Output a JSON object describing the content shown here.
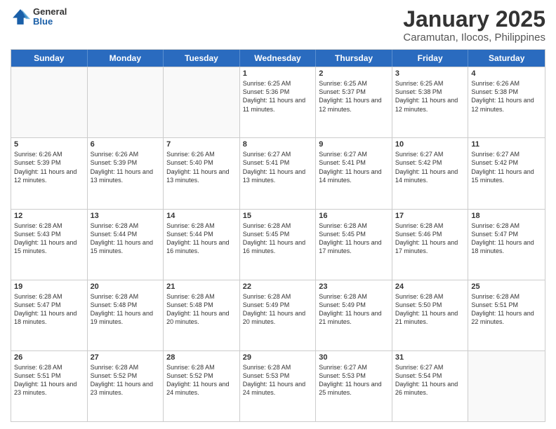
{
  "logo": {
    "general": "General",
    "blue": "Blue"
  },
  "header": {
    "title": "January 2025",
    "subtitle": "Caramutan, Ilocos, Philippines"
  },
  "weekdays": [
    "Sunday",
    "Monday",
    "Tuesday",
    "Wednesday",
    "Thursday",
    "Friday",
    "Saturday"
  ],
  "weeks": [
    [
      {
        "day": "",
        "info": "",
        "empty": true
      },
      {
        "day": "",
        "info": "",
        "empty": true
      },
      {
        "day": "",
        "info": "",
        "empty": true
      },
      {
        "day": "1",
        "info": "Sunrise: 6:25 AM\nSunset: 5:36 PM\nDaylight: 11 hours and 11 minutes.",
        "empty": false
      },
      {
        "day": "2",
        "info": "Sunrise: 6:25 AM\nSunset: 5:37 PM\nDaylight: 11 hours and 12 minutes.",
        "empty": false
      },
      {
        "day": "3",
        "info": "Sunrise: 6:25 AM\nSunset: 5:38 PM\nDaylight: 11 hours and 12 minutes.",
        "empty": false
      },
      {
        "day": "4",
        "info": "Sunrise: 6:26 AM\nSunset: 5:38 PM\nDaylight: 11 hours and 12 minutes.",
        "empty": false
      }
    ],
    [
      {
        "day": "5",
        "info": "Sunrise: 6:26 AM\nSunset: 5:39 PM\nDaylight: 11 hours and 12 minutes.",
        "empty": false
      },
      {
        "day": "6",
        "info": "Sunrise: 6:26 AM\nSunset: 5:39 PM\nDaylight: 11 hours and 13 minutes.",
        "empty": false
      },
      {
        "day": "7",
        "info": "Sunrise: 6:26 AM\nSunset: 5:40 PM\nDaylight: 11 hours and 13 minutes.",
        "empty": false
      },
      {
        "day": "8",
        "info": "Sunrise: 6:27 AM\nSunset: 5:41 PM\nDaylight: 11 hours and 13 minutes.",
        "empty": false
      },
      {
        "day": "9",
        "info": "Sunrise: 6:27 AM\nSunset: 5:41 PM\nDaylight: 11 hours and 14 minutes.",
        "empty": false
      },
      {
        "day": "10",
        "info": "Sunrise: 6:27 AM\nSunset: 5:42 PM\nDaylight: 11 hours and 14 minutes.",
        "empty": false
      },
      {
        "day": "11",
        "info": "Sunrise: 6:27 AM\nSunset: 5:42 PM\nDaylight: 11 hours and 15 minutes.",
        "empty": false
      }
    ],
    [
      {
        "day": "12",
        "info": "Sunrise: 6:28 AM\nSunset: 5:43 PM\nDaylight: 11 hours and 15 minutes.",
        "empty": false
      },
      {
        "day": "13",
        "info": "Sunrise: 6:28 AM\nSunset: 5:44 PM\nDaylight: 11 hours and 15 minutes.",
        "empty": false
      },
      {
        "day": "14",
        "info": "Sunrise: 6:28 AM\nSunset: 5:44 PM\nDaylight: 11 hours and 16 minutes.",
        "empty": false
      },
      {
        "day": "15",
        "info": "Sunrise: 6:28 AM\nSunset: 5:45 PM\nDaylight: 11 hours and 16 minutes.",
        "empty": false
      },
      {
        "day": "16",
        "info": "Sunrise: 6:28 AM\nSunset: 5:45 PM\nDaylight: 11 hours and 17 minutes.",
        "empty": false
      },
      {
        "day": "17",
        "info": "Sunrise: 6:28 AM\nSunset: 5:46 PM\nDaylight: 11 hours and 17 minutes.",
        "empty": false
      },
      {
        "day": "18",
        "info": "Sunrise: 6:28 AM\nSunset: 5:47 PM\nDaylight: 11 hours and 18 minutes.",
        "empty": false
      }
    ],
    [
      {
        "day": "19",
        "info": "Sunrise: 6:28 AM\nSunset: 5:47 PM\nDaylight: 11 hours and 18 minutes.",
        "empty": false
      },
      {
        "day": "20",
        "info": "Sunrise: 6:28 AM\nSunset: 5:48 PM\nDaylight: 11 hours and 19 minutes.",
        "empty": false
      },
      {
        "day": "21",
        "info": "Sunrise: 6:28 AM\nSunset: 5:48 PM\nDaylight: 11 hours and 20 minutes.",
        "empty": false
      },
      {
        "day": "22",
        "info": "Sunrise: 6:28 AM\nSunset: 5:49 PM\nDaylight: 11 hours and 20 minutes.",
        "empty": false
      },
      {
        "day": "23",
        "info": "Sunrise: 6:28 AM\nSunset: 5:49 PM\nDaylight: 11 hours and 21 minutes.",
        "empty": false
      },
      {
        "day": "24",
        "info": "Sunrise: 6:28 AM\nSunset: 5:50 PM\nDaylight: 11 hours and 21 minutes.",
        "empty": false
      },
      {
        "day": "25",
        "info": "Sunrise: 6:28 AM\nSunset: 5:51 PM\nDaylight: 11 hours and 22 minutes.",
        "empty": false
      }
    ],
    [
      {
        "day": "26",
        "info": "Sunrise: 6:28 AM\nSunset: 5:51 PM\nDaylight: 11 hours and 23 minutes.",
        "empty": false
      },
      {
        "day": "27",
        "info": "Sunrise: 6:28 AM\nSunset: 5:52 PM\nDaylight: 11 hours and 23 minutes.",
        "empty": false
      },
      {
        "day": "28",
        "info": "Sunrise: 6:28 AM\nSunset: 5:52 PM\nDaylight: 11 hours and 24 minutes.",
        "empty": false
      },
      {
        "day": "29",
        "info": "Sunrise: 6:28 AM\nSunset: 5:53 PM\nDaylight: 11 hours and 24 minutes.",
        "empty": false
      },
      {
        "day": "30",
        "info": "Sunrise: 6:27 AM\nSunset: 5:53 PM\nDaylight: 11 hours and 25 minutes.",
        "empty": false
      },
      {
        "day": "31",
        "info": "Sunrise: 6:27 AM\nSunset: 5:54 PM\nDaylight: 11 hours and 26 minutes.",
        "empty": false
      },
      {
        "day": "",
        "info": "",
        "empty": true
      }
    ]
  ]
}
